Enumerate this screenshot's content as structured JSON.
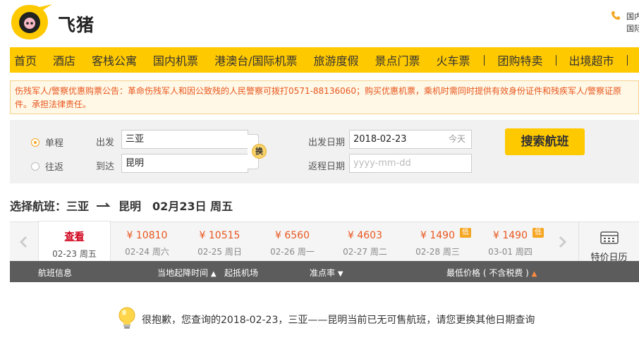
{
  "header": {
    "brand": "飞猪",
    "hotline_lines": [
      "国内",
      "国际"
    ]
  },
  "nav": {
    "items": [
      "首页",
      "酒店",
      "客栈公寓",
      "国内机票",
      "港澳台/国际机票",
      "旅游度假",
      "景点门票",
      "火车票",
      "团购特卖",
      "出境超市"
    ]
  },
  "notice": {
    "text": "伤残军人/警察优惠购票公告：革命伤残军人和因公致残的人民警察可拨打0571-88136060；购买优惠机票，乘机时需同时提供有效身份证件和残疾军人/警察证原件。承担法律责任。"
  },
  "search": {
    "trip_types": [
      "单程",
      "往返"
    ],
    "selected_trip": "单程",
    "from_label": "出发",
    "from_value": "三亚",
    "to_label": "到达",
    "to_value": "昆明",
    "swap_label": "换",
    "depart_label": "出发日期",
    "depart_value": "2018-02-23",
    "depart_hint": "今天",
    "return_label": "返程日期",
    "return_placeholder": "yyyy-mm-dd",
    "search_button": "搜索航班"
  },
  "route": {
    "prefix": "选择航班：",
    "from": "三亚",
    "to": "昆明",
    "date": "02月23日 周五"
  },
  "date_tabs": [
    {
      "price": "查看",
      "date": "02-23 周五",
      "active": true,
      "low": false
    },
    {
      "price": "¥ 10810",
      "date": "02-24 周六",
      "active": false,
      "low": false
    },
    {
      "price": "¥ 10515",
      "date": "02-25 周日",
      "active": false,
      "low": false
    },
    {
      "price": "¥ 6560",
      "date": "02-26 周一",
      "active": false,
      "low": false
    },
    {
      "price": "¥ 4603",
      "date": "02-27 周二",
      "active": false,
      "low": false
    },
    {
      "price": "¥ 1490",
      "date": "02-28 周三",
      "active": false,
      "low": true
    },
    {
      "price": "¥ 1490",
      "date": "03-01 周四",
      "active": false,
      "low": true
    }
  ],
  "low_badge": "低",
  "special_calendar": "特价日历",
  "table_header": {
    "flight_info": "航班信息",
    "time": "当地起降时间",
    "airport": "起抵机场",
    "ontime": "准点率",
    "price": "最低价格",
    "price_note": "( 不含税费 )"
  },
  "message": "很抱歉，您查询的2018-02-23，三亚——昆明当前已无可售航班，请您更换其他日期查询",
  "colors": {
    "brand_yellow": "#ffc900",
    "price_orange": "#e8561e",
    "notice_bg": "#fff8e6"
  }
}
